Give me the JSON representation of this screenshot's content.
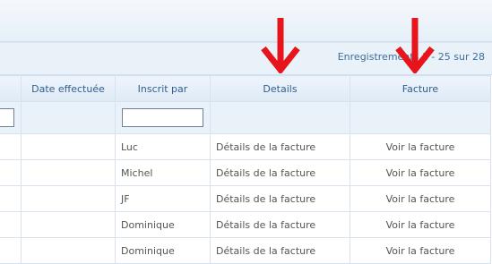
{
  "pager": {
    "text": "Enregistrements 1 - 25 sur 28"
  },
  "columns": {
    "date": "Date effectuée",
    "inscrit": "Inscrit par",
    "details": "Details",
    "facture": "Facture"
  },
  "rows": [
    {
      "inscrit": "Luc",
      "details": "Détails de la facture",
      "facture": "Voir la facture"
    },
    {
      "inscrit": "Michel",
      "details": "Détails de la facture",
      "facture": "Voir la facture"
    },
    {
      "inscrit": "JF",
      "details": "Détails de la facture",
      "facture": "Voir la facture"
    },
    {
      "inscrit": "Dominique",
      "details": "Détails de la facture",
      "facture": "Voir la facture"
    },
    {
      "inscrit": "Dominique",
      "details": "Détails de la facture",
      "facture": "Voir la facture"
    }
  ],
  "annotations": {
    "arrow_color": "#e8141b"
  }
}
